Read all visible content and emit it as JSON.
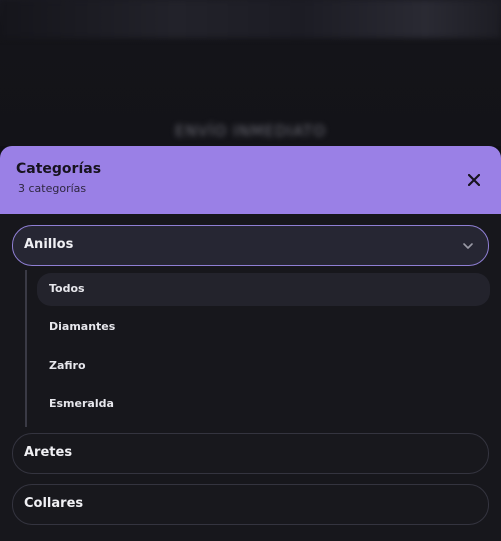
{
  "background": {
    "blurred_text": "ENVÍO INMEDIATO"
  },
  "sheet": {
    "title": "Categorías",
    "subtitle": "3 categorías",
    "close_icon": "close-icon",
    "header_color": "#9a80e6"
  },
  "categories": [
    {
      "label": "Anillos",
      "expanded": true,
      "subcategories": [
        {
          "label": "Todos",
          "active": true
        },
        {
          "label": "Diamantes",
          "active": false
        },
        {
          "label": "Zafiro",
          "active": false
        },
        {
          "label": "Esmeralda",
          "active": false
        }
      ]
    },
    {
      "label": "Aretes",
      "expanded": false
    },
    {
      "label": "Collares",
      "expanded": false
    }
  ]
}
